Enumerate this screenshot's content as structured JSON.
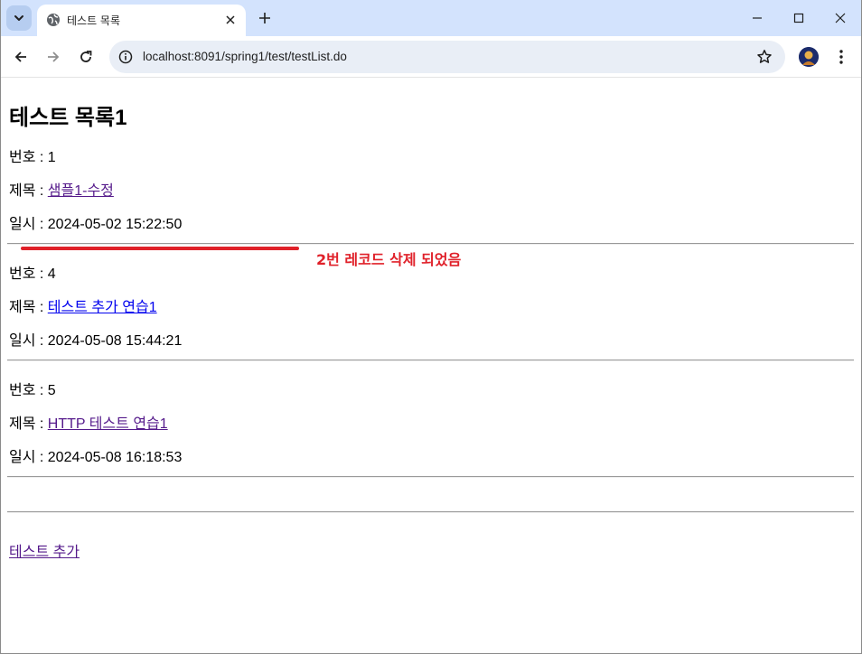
{
  "browser": {
    "tab_title": "테스트 목록",
    "url": "localhost:8091/spring1/test/testList.do"
  },
  "page": {
    "title": "테스트 목록1",
    "records": [
      {
        "no_text": "번호 : 1",
        "subject_label": "제목 : ",
        "subject_link": "샘플1-수정",
        "date_text": "일시 : 2024-05-02 15:22:50"
      },
      {
        "no_text": "번호 : 4",
        "subject_label": "제목 : ",
        "subject_link": "테스트 추가 연습1",
        "date_text": "일시 : 2024-05-08 15:44:21"
      },
      {
        "no_text": "번호 : 5",
        "subject_label": "제목 : ",
        "subject_link": "HTTP 테스트 연습1",
        "date_text": "일시 : 2024-05-08 16:18:53"
      }
    ],
    "add_link": "테스트 추가"
  },
  "annotation": {
    "text": "2번 레코드 삭제 되었음",
    "color": "#e0212a"
  },
  "colors": {
    "tabstrip": "#d3e3fd",
    "omnibox": "#e9eef6",
    "visited_link": "#551a8b",
    "link": "#0000ee"
  }
}
